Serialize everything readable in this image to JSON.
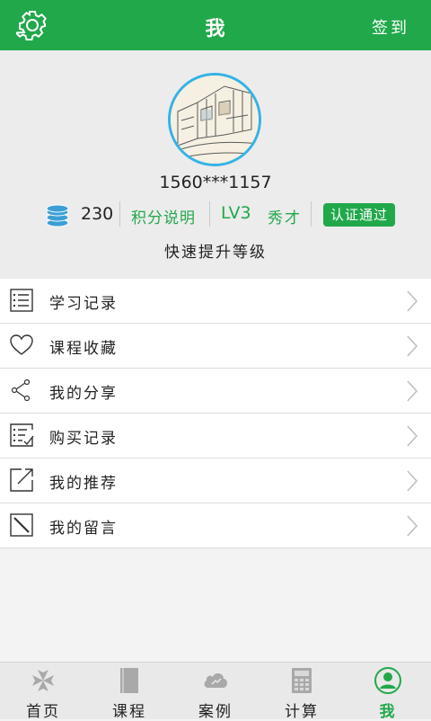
{
  "header": {
    "title": "我",
    "checkin_label": "签到"
  },
  "profile": {
    "phone": "1560***1157",
    "points": "230",
    "points_explain": "积分说明",
    "level": "LV3",
    "level_name": "秀才",
    "verified_badge": "认证通过",
    "upgrade_link": "快速提升等级"
  },
  "menu": [
    {
      "label": "学习记录",
      "icon": "list-icon"
    },
    {
      "label": "课程收藏",
      "icon": "heart-icon"
    },
    {
      "label": "我的分享",
      "icon": "share-icon"
    },
    {
      "label": "购买记录",
      "icon": "checklist-icon"
    },
    {
      "label": "我的推荐",
      "icon": "external-link-icon"
    },
    {
      "label": "我的留言",
      "icon": "edit-icon"
    }
  ],
  "tabs": [
    {
      "label": "首页",
      "icon": "home-flower-icon",
      "active": false
    },
    {
      "label": "课程",
      "icon": "book-icon",
      "active": false
    },
    {
      "label": "案例",
      "icon": "cloud-icon",
      "active": false
    },
    {
      "label": "计算",
      "icon": "calculator-icon",
      "active": false
    },
    {
      "label": "我",
      "icon": "profile-icon",
      "active": true
    }
  ],
  "colors": {
    "primary": "#21a84b",
    "avatar_border": "#35b3e6",
    "coin": "#3b9fd6"
  }
}
